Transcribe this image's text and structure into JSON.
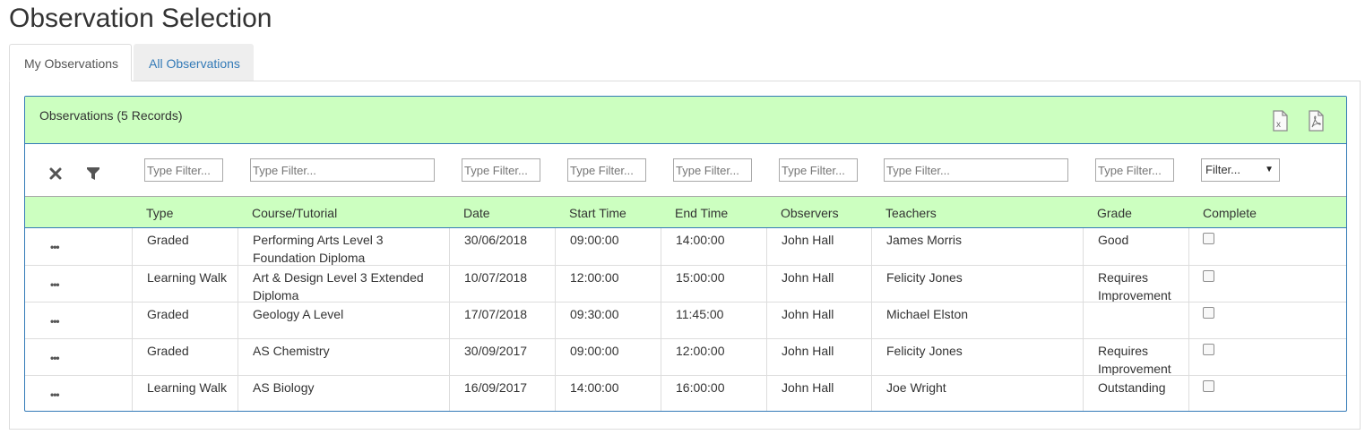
{
  "page": {
    "title": "Observation Selection"
  },
  "tabs": [
    {
      "label": "My Observations",
      "active": true
    },
    {
      "label": "All Observations",
      "active": false
    }
  ],
  "panel": {
    "title": "Observations (5 Records)",
    "export_icons": [
      "excel-export-icon",
      "pdf-export-icon"
    ]
  },
  "filters": {
    "placeholder": "Type Filter...",
    "select_value": "Filter...",
    "icons": [
      "clear-filter-icon",
      "funnel-icon"
    ]
  },
  "columns": [
    "Type",
    "Course/Tutorial",
    "Date",
    "Start Time",
    "End Time",
    "Observers",
    "Teachers",
    "Grade",
    "Complete"
  ],
  "rows": [
    {
      "type": "Graded",
      "course": "Performing Arts Level 3 Foundation Diploma",
      "date": "30/06/2018",
      "start": "09:00:00",
      "end": "14:00:00",
      "observers": "John Hall",
      "teachers": "James Morris",
      "grade": "Good",
      "complete": false
    },
    {
      "type": "Learning Walk",
      "course": "Art & Design Level 3 Extended Diploma",
      "date": "10/07/2018",
      "start": "12:00:00",
      "end": "15:00:00",
      "observers": "John Hall",
      "teachers": "Felicity Jones",
      "grade": "Requires Improvement",
      "complete": false
    },
    {
      "type": "Graded",
      "course": "Geology A Level",
      "date": "17/07/2018",
      "start": "09:30:00",
      "end": "11:45:00",
      "observers": "John Hall",
      "teachers": "Michael Elston",
      "grade": "",
      "complete": false
    },
    {
      "type": "Graded",
      "course": "AS Chemistry",
      "date": "30/09/2017",
      "start": "09:00:00",
      "end": "12:00:00",
      "observers": "John Hall",
      "teachers": "Felicity Jones",
      "grade": "Requires Improvement",
      "complete": false
    },
    {
      "type": "Learning Walk",
      "course": "AS Biology",
      "date": "16/09/2017",
      "start": "14:00:00",
      "end": "16:00:00",
      "observers": "John Hall",
      "teachers": "Joe Wright",
      "grade": "Outstanding",
      "complete": false
    }
  ],
  "row_menu_glyph": "•••",
  "colors": {
    "header_bg": "#ccffc0",
    "border_blue": "#337ab7",
    "link_blue": "#337ab7"
  }
}
